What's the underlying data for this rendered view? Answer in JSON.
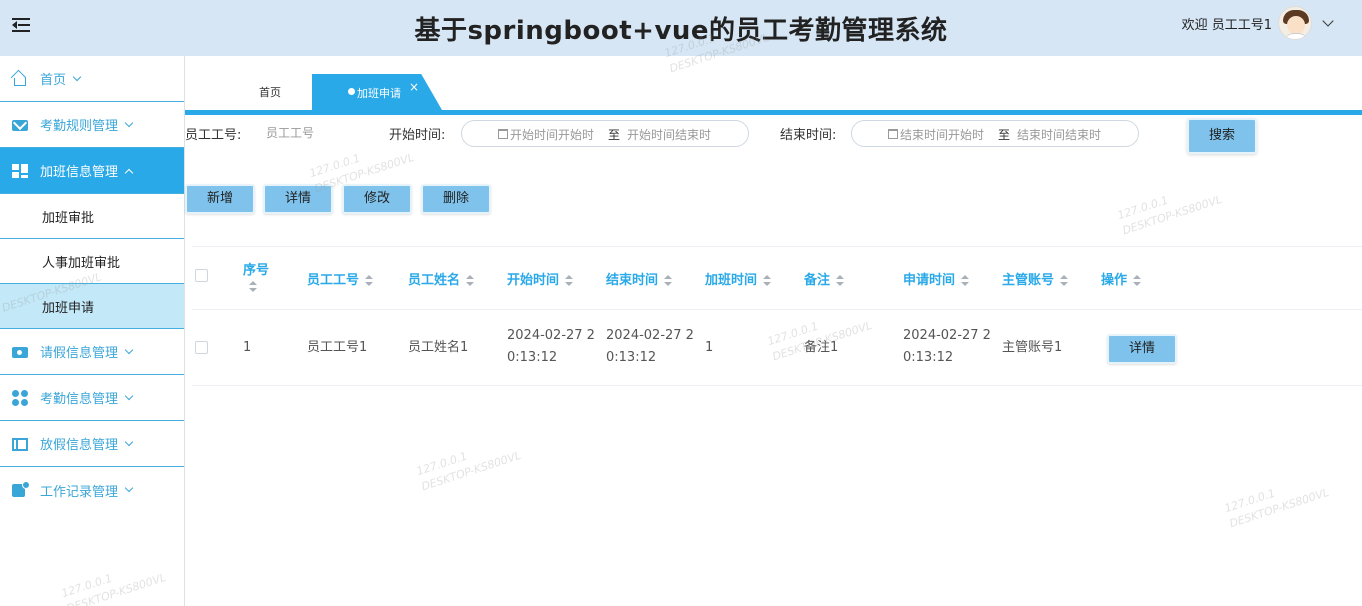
{
  "header": {
    "title": "基于springboot+vue的员工考勤管理系统",
    "welcome": "欢迎 员工工号1",
    "menu_icon": "hamburger-fold-icon",
    "avatar_icon": "user-avatar"
  },
  "sidebar": {
    "items": [
      {
        "label": "首页",
        "icon": "home-icon"
      },
      {
        "label": "考勤规则管理",
        "icon": "mail-icon"
      },
      {
        "label": "加班信息管理",
        "icon": "dashboard-icon",
        "active": true,
        "children": [
          {
            "label": "加班审批"
          },
          {
            "label": "人事加班审批"
          },
          {
            "label": "加班申请",
            "selected": true
          }
        ]
      },
      {
        "label": "请假信息管理",
        "icon": "card-icon"
      },
      {
        "label": "考勤信息管理",
        "icon": "dots-icon"
      },
      {
        "label": "放假信息管理",
        "icon": "book-icon"
      },
      {
        "label": "工作记录管理",
        "icon": "note-icon"
      }
    ]
  },
  "tabs": {
    "home": "首页",
    "active": "加班申请",
    "close": "×"
  },
  "filter": {
    "emp_no_label": "员工工号:",
    "emp_no_placeholder": "员工工号",
    "start_label": "开始时间:",
    "start_from": "开始时间开始时",
    "start_to": "开始时间结束时",
    "end_label": "结束时间:",
    "end_from": "结束时间开始时",
    "end_to": "结束时间结束时",
    "range_sep": "至",
    "search": "搜索"
  },
  "actions": {
    "add": "新增",
    "detail": "详情",
    "edit": "修改",
    "delete": "删除"
  },
  "table": {
    "columns": [
      "序号",
      "员工工号",
      "员工姓名",
      "开始时间",
      "结束时间",
      "加班时间",
      "备注",
      "申请时间",
      "主管账号",
      "操作"
    ],
    "rows": [
      {
        "index": "1",
        "emp_no": "员工工号1",
        "emp_name": "员工姓名1",
        "start_time_1": "2024-02-27 2",
        "start_time_2": "0:13:12",
        "end_time_1": "2024-02-27 2",
        "end_time_2": "0:13:12",
        "overtime": "1",
        "remark": "备注1",
        "apply_time_1": "2024-02-27 2",
        "apply_time_2": "0:13:12",
        "manager": "主管账号1",
        "action": "详情"
      }
    ]
  },
  "watermark": {
    "line1": "127.0.0.1",
    "line2": "DESKTOP-KS800VL"
  },
  "colors": {
    "header_bg": "#d6e6f5",
    "accent": "#2aa9e8",
    "button_bg": "#7fc3ec",
    "submenu_selected": "#c3e8f8"
  }
}
